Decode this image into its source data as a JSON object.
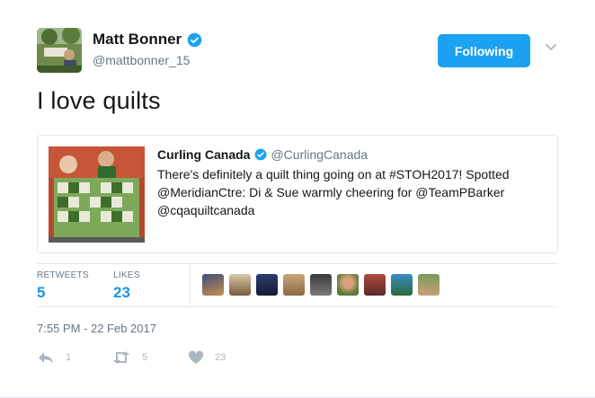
{
  "author": {
    "name": "Matt Bonner",
    "handle": "@mattbonner_15"
  },
  "follow_button": {
    "label": "Following"
  },
  "tweet": {
    "text": "I love quilts"
  },
  "quote": {
    "name": "Curling Canada",
    "handle": "@CurlingCanada",
    "lines": [
      "There's definitely a quilt thing going on at #STOH2017! Spotted",
      "@MeridianCtre: Di & Sue warmly cheering for @TeamPBarker",
      "@cqaquiltcanada"
    ]
  },
  "stats": {
    "retweets_label": "RETWEETS",
    "retweets_value": "5",
    "likes_label": "LIKES",
    "likes_value": "23"
  },
  "timestamp": "7:55 PM - 22 Feb 2017",
  "actions": {
    "reply_count": "1",
    "retweet_count": "5",
    "like_count": "23"
  },
  "colors": {
    "accent": "#1da1f2",
    "link": "#1b95e0",
    "muted": "#657786",
    "icon": "#aab8c2",
    "border": "#e1e8ed"
  },
  "icons": [
    "verified-badge-icon",
    "chevron-down-icon",
    "reply-icon",
    "retweet-icon",
    "heart-icon"
  ]
}
